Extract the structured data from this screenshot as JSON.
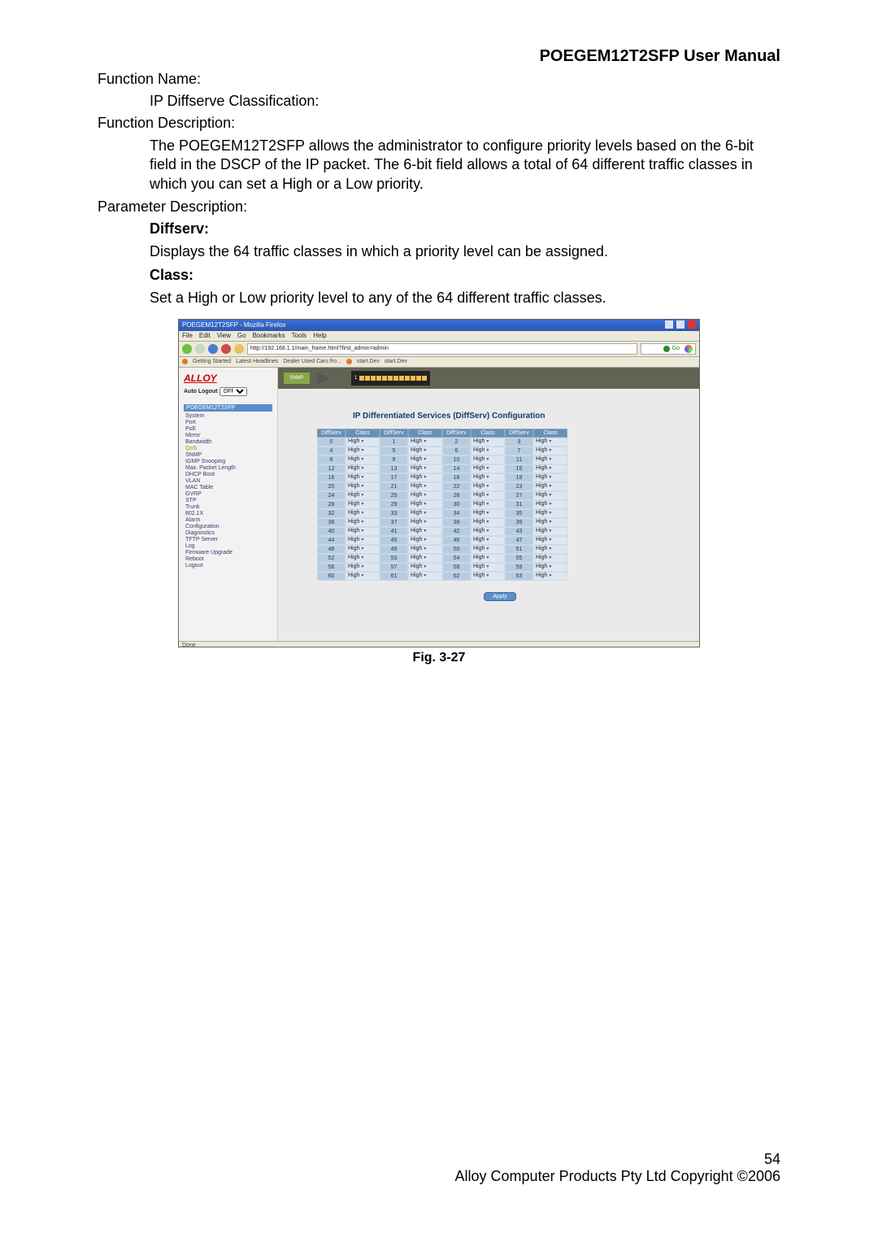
{
  "header_title": "POEGEM12T2SFP User Manual",
  "labels": {
    "function_name": "Function Name:",
    "function_name_val": "IP Diffserve Classification:",
    "function_desc": "Function Description:",
    "function_desc_body": "The POEGEM12T2SFP allows the administrator to configure priority levels based on the 6-bit field in the DSCP of the IP packet. The 6-bit field allows a total of 64 different traffic classes in which you can set a High or a Low priority.",
    "parameter_desc": "Parameter Description:",
    "diffserv": "Diffserv:",
    "diffserv_body": "Displays the 64 traffic classes in which a priority level can be assigned.",
    "class": "Class:",
    "class_body": "Set a High or Low priority level to any of the 64 different traffic classes."
  },
  "figure_caption": "Fig. 3-27",
  "footer": {
    "page_no": "54",
    "copyright": "Alloy Computer Products Pty Ltd Copyright ©2006"
  },
  "browser": {
    "window_title": "POEGEM12T2SFP - Mozilla Firefox",
    "menu": [
      "File",
      "Edit",
      "View",
      "Go",
      "Bookmarks",
      "Tools",
      "Help"
    ],
    "url": "http://192.168.1.1/main_frame.html?first_admin=admin",
    "go_label": "Go",
    "bookmarks": [
      "Getting Started",
      "Latest Headlines",
      "Dealer Used Cars fro...",
      "start.Dev",
      "start.Dev"
    ],
    "status": "Done"
  },
  "sidebar": {
    "logo": "ALLOY",
    "auto_logout_label": "Auto Logout",
    "auto_logout_value": "OFF",
    "model": "POEGEM12T2SFP",
    "menu": [
      "System",
      "Port",
      "PoE",
      "Mirror",
      "Bandwidth",
      "QoS",
      "SNMP",
      "IGMP Snooping",
      "Max. Packet Length",
      "DHCP Boot",
      "VLAN",
      "MAC Table",
      "GVRP",
      "STP",
      "Trunk",
      "802.1X",
      "Alarm",
      "Configuration",
      "Diagnostics",
      "TFTP Server",
      "Log",
      "Firmware Upgrade",
      "Reboot",
      "Logout"
    ],
    "selected": "QoS"
  },
  "device_banner": {
    "badge": "SNMP",
    "port_label": "1"
  },
  "config": {
    "title": "IP Differentiated Services (DiffServ) Configuration",
    "col_headers": [
      "DiffServ",
      "Class",
      "DiffServ",
      "Class",
      "DiffServ",
      "Class",
      "DiffServ",
      "Class"
    ],
    "priority_value": "High",
    "apply": "Apply"
  },
  "chart_data": {
    "type": "table",
    "title": "IP Differentiated Services (DiffServ) Configuration",
    "columns": [
      "DiffServ",
      "Class"
    ],
    "rows_diffserv": [
      0,
      1,
      2,
      3,
      4,
      5,
      6,
      7,
      8,
      9,
      10,
      11,
      12,
      13,
      14,
      15,
      16,
      17,
      18,
      19,
      20,
      21,
      22,
      23,
      24,
      25,
      26,
      27,
      28,
      29,
      30,
      31,
      32,
      33,
      34,
      35,
      36,
      37,
      38,
      39,
      40,
      41,
      42,
      43,
      44,
      45,
      46,
      47,
      48,
      49,
      50,
      51,
      52,
      53,
      54,
      55,
      56,
      57,
      58,
      59,
      60,
      61,
      62,
      63
    ],
    "rows_class": [
      "High",
      "High",
      "High",
      "High",
      "High",
      "High",
      "High",
      "High",
      "High",
      "High",
      "High",
      "High",
      "High",
      "High",
      "High",
      "High",
      "High",
      "High",
      "High",
      "High",
      "High",
      "High",
      "High",
      "High",
      "High",
      "High",
      "High",
      "High",
      "High",
      "High",
      "High",
      "High",
      "High",
      "High",
      "High",
      "High",
      "High",
      "High",
      "High",
      "High",
      "High",
      "High",
      "High",
      "High",
      "High",
      "High",
      "High",
      "High",
      "High",
      "High",
      "High",
      "High",
      "High",
      "High",
      "High",
      "High",
      "High",
      "High",
      "High",
      "High",
      "High",
      "High",
      "High",
      "High"
    ]
  }
}
